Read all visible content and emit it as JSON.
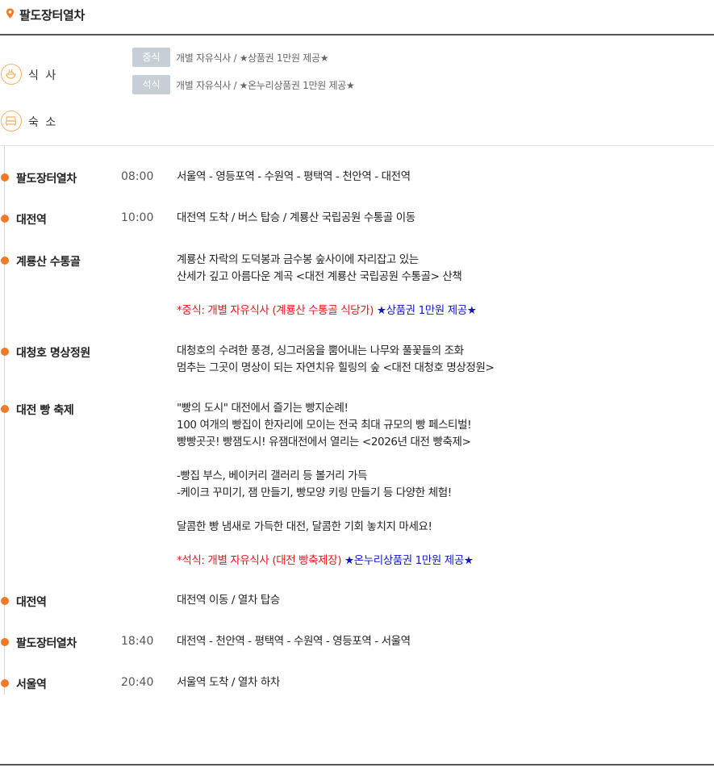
{
  "header": {
    "title": "팔도장터열차",
    "icon": "location-pin-icon",
    "icon_color": "#f07a25"
  },
  "services": {
    "meal": {
      "label": "식 사",
      "icon": "rice-bowl-icon",
      "items": [
        {
          "tag": "중식",
          "text": "개별 자유식사 / ★상품권 1만원 제공★"
        },
        {
          "tag": "석식",
          "text": "개별 자유식사 / ★온누리상품권 1만원 제공★"
        }
      ]
    },
    "lodging": {
      "label": "숙 소",
      "icon": "bed-icon"
    }
  },
  "schedule": [
    {
      "name": "팔도장터열차",
      "time": "08:00",
      "desc": [
        "서울역 - 영등포역 - 수원역 - 평택역 - 천안역 - 대전역"
      ]
    },
    {
      "name": "대전역",
      "time": "10:00",
      "desc": [
        "대전역 도착 / 버스 탑승 / 계룡산 국립공원 수통골 이동"
      ]
    },
    {
      "name": "계룡산 수통골",
      "time": "",
      "desc": [
        "계룡산 자락의 도덕봉과 금수봉 숲사이에 자리잡고 있는",
        "산세가 깊고 아름다운 계곡 <대전 계룡산 국립공원 수통골> 산책"
      ],
      "note_red": "*중식: 개별 자유식사 (계룡산 수통골 식당가)",
      "note_blue": " ★상품권 1만원 제공★"
    },
    {
      "name": "대청호 명상정원",
      "time": "",
      "desc": [
        "대청호의 수려한 풍경, 싱그러움을 뿜어내는 나무와 풀꽃들의 조화",
        "멈추는 그곳이 명상이 되는 자연치유 힐링의 숲 <대전 대청호 명상정원>"
      ]
    },
    {
      "name": "대전 빵 축제",
      "time": "",
      "desc": [
        "\"빵의 도시\" 대전에서 즐기는 빵지순례!",
        "100 여개의 빵집이 한자리에 모이는 전국 최대 규모의 빵 페스티벌!",
        "빵빵곳곳! 빵잼도시! 유잼대전에서 열리는 <2026년 대전 빵축제>",
        "-빵집 부스, 베이커리 갤러리 등 볼거리 가득",
        "-케이크 꾸미기, 잼 만들기, 빵모양 키링 만들기 등 다양한 체험!",
        "달콤한 빵 냄새로 가득한 대전, 달콤한 기회 놓치지 마세요!"
      ],
      "note_red": "*석식: 개별 자유식사 (대전 빵축제장)",
      "note_blue": " ★온누리상품권 1만원 제공★"
    },
    {
      "name": "대전역",
      "time": "",
      "desc": [
        "대전역 이동 / 열차 탑승"
      ]
    },
    {
      "name": "팔도장터열차",
      "time": "18:40",
      "desc": [
        "대전역 - 천안역 - 평택역 - 수원역 - 영등포역 - 서울역"
      ]
    },
    {
      "name": "서울역",
      "time": "20:40",
      "desc": [
        "서울역 도착 / 열차 하차"
      ]
    }
  ],
  "colors": {
    "accent": "#f07a25",
    "icon_ring": "#f2b36a",
    "tag_bg": "#c8ced6",
    "note_red": "#e8161e",
    "note_blue": "#1018c8"
  }
}
